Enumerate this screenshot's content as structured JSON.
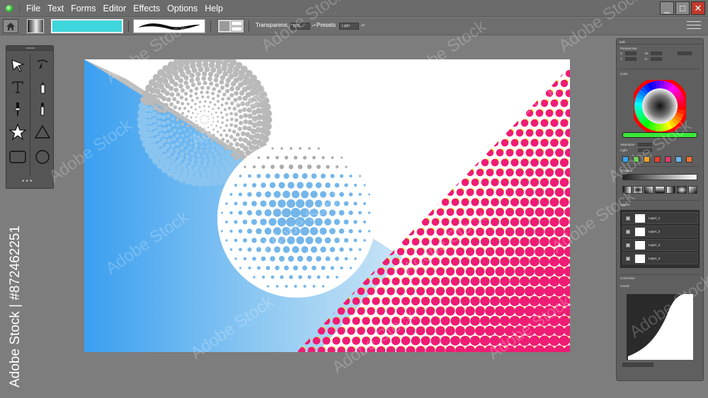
{
  "menu": {
    "items": [
      "File",
      "Text",
      "Forms",
      "Editor",
      "Effects",
      "Options",
      "Help"
    ]
  },
  "window_controls": {
    "minimize": "_",
    "maximize": "□",
    "close": "✕"
  },
  "toolbar": {
    "color_value": "#3dd6dc",
    "transparency_label": "Transparenc",
    "transparency_value": "55%",
    "presets_label": "Presets",
    "presets_value": "Light"
  },
  "tools": [
    "select-arrow-icon",
    "pen-nib-icon",
    "text-tool-icon",
    "marker-icon",
    "dropper-icon",
    "brush-icon",
    "star-icon",
    "triangle-icon",
    "rounded-rect-icon",
    "circle-icon"
  ],
  "side_watermark": "Adobe Stock | #872462251",
  "watermark_text": "Adobe Stock",
  "right_panel": {
    "title": "Edit",
    "perspective_label": "Perspective",
    "persp_fields": [
      "X",
      "Y",
      "W",
      "H"
    ],
    "color_label": "Color",
    "saturation_label": "Saturation",
    "light_label": "Light",
    "gradient_label": "Gradient",
    "layers_label": "Layers",
    "layers": [
      "Layer_1",
      "Layer_2",
      "Layer_3",
      "Layer_4"
    ],
    "correction_label": "Correction",
    "levels_label": "Levels",
    "swatch_colors": [
      "#3aa4e8",
      "#5fc648",
      "#f0a020",
      "#e8402a",
      "#e03a6a",
      "#6ab6e8",
      "#f07030"
    ],
    "hue_bar_color": "#38e838"
  }
}
